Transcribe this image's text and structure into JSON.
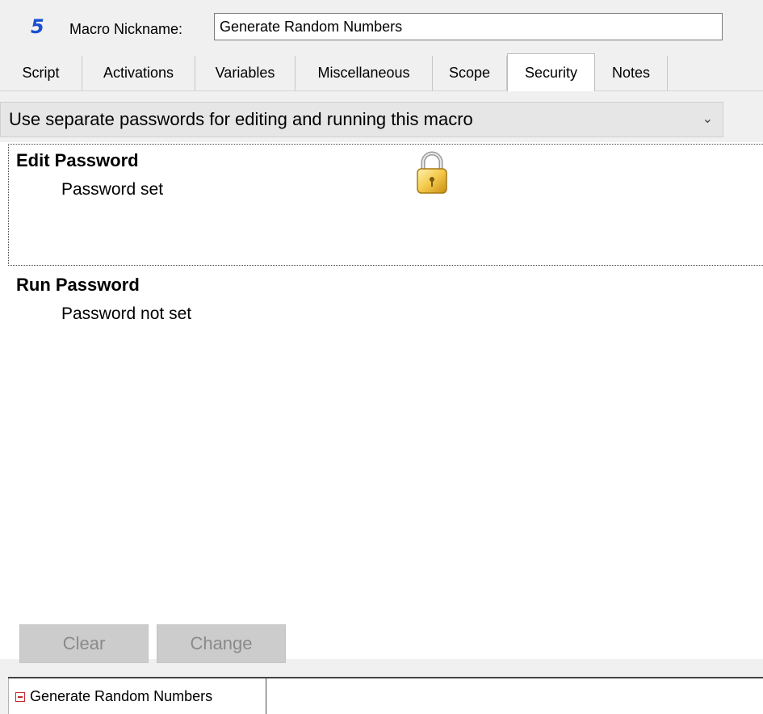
{
  "header": {
    "app_number": "5",
    "nickname_label": "Macro Nickname:",
    "nickname_value": "Generate Random Numbers"
  },
  "tabs": [
    {
      "label": "Script"
    },
    {
      "label": "Activations"
    },
    {
      "label": "Variables"
    },
    {
      "label": "Miscellaneous"
    },
    {
      "label": "Scope"
    },
    {
      "label": "Security",
      "active": true
    },
    {
      "label": "Notes"
    }
  ],
  "security": {
    "mode": "Use separate passwords for editing and running this macro",
    "edit_title": "Edit Password",
    "edit_status": "Password set",
    "run_title": "Run Password",
    "run_status": "Password not set",
    "clear_label": "Clear",
    "change_label": "Change"
  },
  "footer": {
    "doc_tab_label": "Generate Random Numbers"
  },
  "icons": {
    "lock": "lock-icon",
    "chevron": "chevron-down-icon",
    "doc": "macro-doc-icon"
  },
  "colors": {
    "accent": "#1a4fd0",
    "lock_gold": "#f3c84a"
  }
}
